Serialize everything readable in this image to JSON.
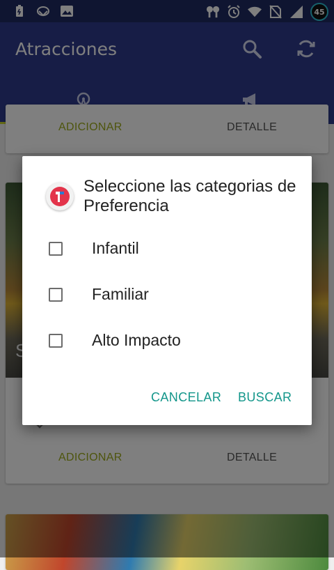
{
  "status_bar": {
    "icons": [
      "battery-saver-icon",
      "vpn-icon",
      "image-icon",
      "earbuds-icon",
      "alarm-icon",
      "wifi-icon",
      "no-sim-icon",
      "signal-icon"
    ],
    "battery_level": "45"
  },
  "toolbar": {
    "title": "Atracciones",
    "actions": [
      "search-icon",
      "refresh-icon"
    ]
  },
  "tabs": [
    {
      "icon": "ferris-wheel-icon",
      "selected": true
    },
    {
      "icon": "megaphone-icon",
      "selected": false
    }
  ],
  "cards": [
    {
      "add_label": "ADICIONAR",
      "detail_label": "DETALLE",
      "photo_caption": "S"
    },
    {
      "add_label": "ADICIONAR",
      "detail_label": "DETALLE"
    }
  ],
  "dialog": {
    "title": "Seleccione las categorias de Preferencia",
    "options": [
      {
        "label": "Infantil",
        "checked": false
      },
      {
        "label": "Familiar",
        "checked": false
      },
      {
        "label": "Alto Impacto",
        "checked": false
      }
    ],
    "cancel_label": "CANCELAR",
    "search_label": "BUSCAR"
  },
  "colors": {
    "status_bar": "#1f2a63",
    "primary": "#2e3b8c",
    "accent": "#c7d22d",
    "dialog_button": "#13968a"
  }
}
